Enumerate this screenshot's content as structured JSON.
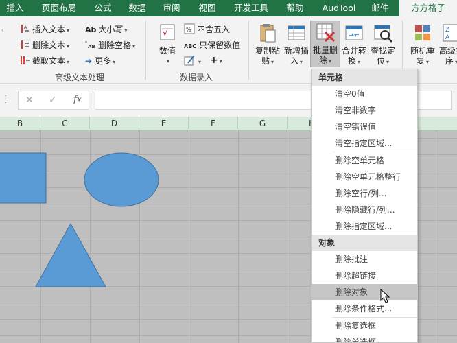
{
  "tabs": [
    {
      "label": "插入"
    },
    {
      "label": "页面布局"
    },
    {
      "label": "公式"
    },
    {
      "label": "数据"
    },
    {
      "label": "审阅"
    },
    {
      "label": "视图"
    },
    {
      "label": "开发工具"
    },
    {
      "label": "帮助"
    },
    {
      "label": "AudTool"
    },
    {
      "label": "邮件"
    },
    {
      "label": "方方格子"
    }
  ],
  "ribbon": {
    "text_group": {
      "insert_text": "插入文本",
      "delete_text": "删除文本",
      "cut_text": "截取文本",
      "case": "大小写",
      "case_icon": "Ab",
      "delete_space": "删除空格",
      "more": "更多",
      "label": "高级文本处理"
    },
    "number_group": {
      "value": "数值",
      "round": "四舍五入",
      "keep_value": "只保留数值",
      "label": "数据录入"
    },
    "buttons": {
      "copy_paste_1": "复制粘",
      "copy_paste_2": "贴",
      "insert_new_1": "新增插",
      "insert_new_2": "入",
      "batch_delete_1": "批量删",
      "batch_delete_2": "除",
      "merge_convert_1": "合并转",
      "merge_convert_2": "换",
      "find_locate_1": "查找定",
      "find_locate_2": "位",
      "random_1": "随机重",
      "random_2": "复",
      "advanced_1": "高级排",
      "advanced_2": "序"
    }
  },
  "formula_bar": {
    "cancel_icon": "✕",
    "confirm_icon": "✓",
    "fx_label": "fx"
  },
  "columns": [
    "B",
    "C",
    "D",
    "E",
    "F",
    "G",
    "H"
  ],
  "colors": {
    "ribbon_green": "#217346",
    "shape_fill": "#5b9bd5",
    "shape_border": "#41719c"
  },
  "menu": {
    "section1": "单元格",
    "items1": [
      "清空0值",
      "清空非数字",
      "清空错误值",
      "清空指定区域..."
    ],
    "items2": [
      "删除空单元格",
      "删除空单元格整行",
      "删除空行/列...",
      "删除隐藏行/列...",
      "删除指定区域..."
    ],
    "section2": "对象",
    "items3": [
      "删除批注",
      "删除超链接",
      "删除对象",
      "删除条件格式..."
    ],
    "items4": [
      "删除复选框",
      "删除单选框"
    ]
  }
}
